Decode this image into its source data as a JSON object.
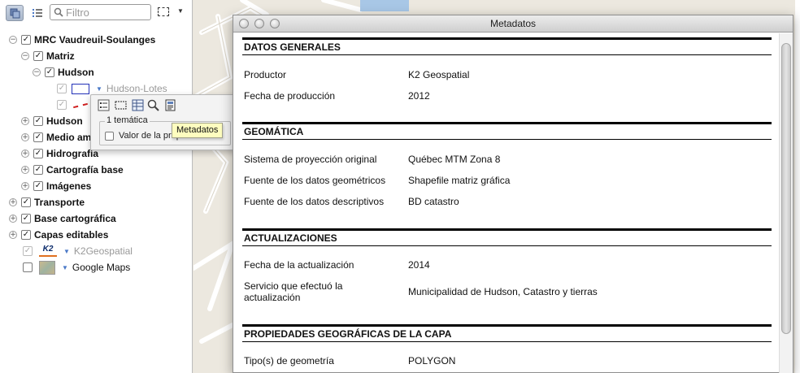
{
  "toolbar": {
    "filter_placeholder": "Filtro"
  },
  "tree": [
    {
      "label": "MRC Vaudreuil-Soulanges",
      "checked": true
    },
    {
      "label": "Matriz",
      "checked": true
    },
    {
      "label": "Hudson",
      "checked": true
    },
    {
      "label": "Hudson-Lotes",
      "checked": true
    },
    {
      "label": "Hudson",
      "checked": true
    },
    {
      "label": "Medio am",
      "checked": true
    },
    {
      "label": "Hidrografía",
      "checked": true
    },
    {
      "label": "Cartografía base",
      "checked": true
    },
    {
      "label": "Imágenes",
      "checked": true
    },
    {
      "label": "Transporte",
      "checked": true
    },
    {
      "label": "Base cartográfica",
      "checked": true
    },
    {
      "label": "Capas editables",
      "checked": true
    },
    {
      "label": "K2Geospatial",
      "checked": true
    },
    {
      "label": "Google Maps",
      "checked": false
    }
  ],
  "popover": {
    "group_title": "1 temática",
    "checkbox_label": "Valor de la propiedad"
  },
  "tooltip": "Metadatos",
  "logo_text": "K2",
  "colors": {
    "map_bg": "#ece8df",
    "road_white": "#ffffff",
    "layer_border": "#2332b8",
    "line_red": "#d02020",
    "disclosure_blue": "#4a78c7"
  },
  "metadata_window": {
    "title": "Metadatos",
    "sections": [
      {
        "heading": "DATOS GENERALES",
        "rows": [
          {
            "key": "Productor",
            "value": "K2 Geospatial"
          },
          {
            "key": "Fecha de producción",
            "value": "2012"
          }
        ]
      },
      {
        "heading": "GEOMÁTICA",
        "rows": [
          {
            "key": "Sistema de proyección original",
            "value": "Québec MTM Zona 8"
          },
          {
            "key": "Fuente de los datos geométricos",
            "value": "Shapefile matriz gráfica"
          },
          {
            "key": "Fuente de los datos descriptivos",
            "value": "BD catastro"
          }
        ]
      },
      {
        "heading": "ACTUALIZACIONES",
        "rows": [
          {
            "key": "Fecha de la actualización",
            "value": "2014"
          },
          {
            "key": "Servicio que efectuó la actualización",
            "value": "Municipalidad de Hudson, Catastro y tierras"
          }
        ]
      },
      {
        "heading": "PROPIEDADES GEOGRÁFICAS DE LA CAPA",
        "rows": [
          {
            "key": "Tipo(s) de geometría",
            "value": "POLYGON"
          }
        ]
      }
    ]
  }
}
